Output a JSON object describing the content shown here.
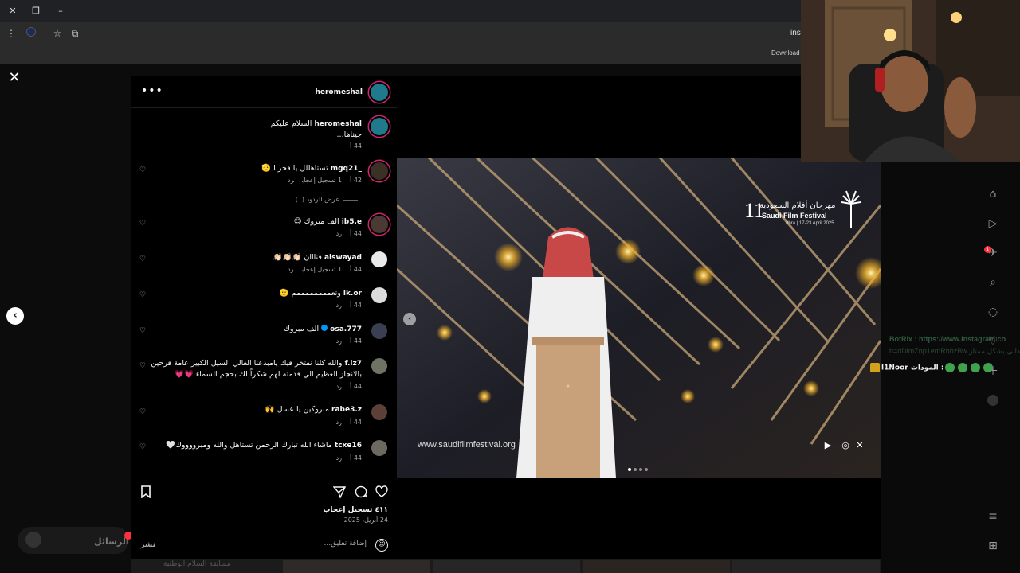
{
  "browser": {
    "url_fragment": "inst",
    "download_label": "Download"
  },
  "post": {
    "author": "heromeshal",
    "caption_user": "heromeshal",
    "caption_line1": "السلام عليكم",
    "caption_line2": "جيناها...",
    "caption_time": "44 أ",
    "likes": "٤١١ تسجيل إعجاب",
    "date": "24 أبريل، 2025",
    "comment_placeholder": "إضافة تعليق...",
    "post_label": "نشر",
    "view_replies": "عرض الردود (1)"
  },
  "comments": [
    {
      "user": "_mgq21",
      "text": "تستاهللل يا فخرنا 🫡",
      "time": "42 أ",
      "likes": "1 تسجيل إعجاب",
      "reply": "رد"
    },
    {
      "user": "ib5.e",
      "text": "الف مبروك 😍",
      "time": "44 أ",
      "likes": "",
      "reply": "رد"
    },
    {
      "user": "alswayad",
      "text": "فنااان 👏🏻👏🏻👏🏻",
      "time": "44 أ",
      "likes": "1 تسجيل إعجاب",
      "reply": "رد"
    },
    {
      "user": "lk.or",
      "text": "وتعممممممممم 🫡",
      "time": "44 أ",
      "likes": "",
      "reply": "رد"
    },
    {
      "user": "osa.777",
      "text": "الف مبروك",
      "time": "44 أ",
      "likes": "",
      "reply": "رد"
    },
    {
      "user": "f.lz7",
      "text": "والله كلنا نفتخر فيك يامبدعنا الغالي السيل الكبير عامة فرحين",
      "text2": "بالانجاز العظيم الي قدمته لهم شكراً لك بحجم السماء 💗💗",
      "time": "44 أ",
      "likes": "",
      "reply": "رد"
    },
    {
      "user": "rabe3.z",
      "text": "مبروكين يا عسل 🙌",
      "time": "44 أ",
      "likes": "",
      "reply": "رد"
    },
    {
      "user": "tcxe16",
      "text": "ماشاء الله تبارك الرحمن تستاهل والله ومبرووووك🤍",
      "time": "44 أ",
      "likes": "",
      "reply": "رد"
    }
  ],
  "media": {
    "watermark": "www.saudifilmfestival.org",
    "festival_number": "11",
    "festival_ar": "مهرجان أفلام السعودية",
    "festival_en": "Saudi Film Festival",
    "festival_date": "Ithra | 17-23 April 2025"
  },
  "background": {
    "messages_label": "الرسائل",
    "bottom_text": "مسابقة السلام الوطنية"
  },
  "chat": {
    "line1": "BotRix : https://www.instagram.co",
    "line2": "h=dDlmZnp1emRhbzBw ميداني بشكل ممتاز",
    "line3_user": "l1Noor",
    "line3_text": "المودات :"
  },
  "sidebar": {
    "badge": "1"
  },
  "colors": {
    "accent_like": "#ff3040",
    "story_ring": "#d3246f",
    "verified": "#0095f6"
  }
}
